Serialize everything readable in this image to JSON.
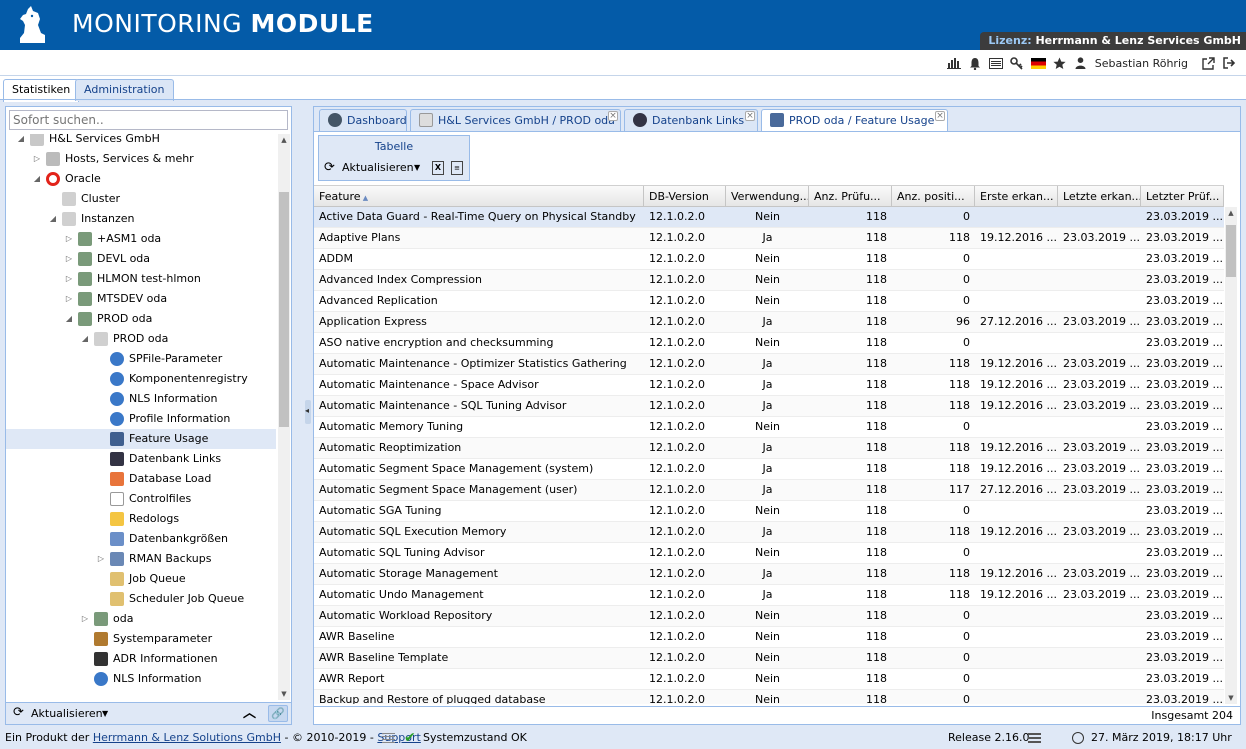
{
  "header": {
    "title_light": "MONITORING ",
    "title_bold": "MODULE",
    "license_label": "Lizenz:",
    "license_value": " Herrmann & Lenz Services GmbH"
  },
  "toolbar": {
    "icons": [
      "chart-icon",
      "bell-icon",
      "list-icon",
      "key-icon",
      "flag-de-icon",
      "star-icon",
      "user-icon",
      "external-link-icon",
      "logout-icon"
    ],
    "user": "Sebastian Röhrig"
  },
  "main_tabs": [
    {
      "label": "Statistiken"
    },
    {
      "label": "Administration"
    }
  ],
  "left": {
    "search_placeholder": "Sofort suchen..",
    "tree": [
      {
        "label": "H&L Services GmbH",
        "level": 2,
        "exp": "open",
        "icon": "building"
      },
      {
        "label": "Hosts, Services & mehr",
        "level": 3,
        "exp": "closed",
        "icon": "server"
      },
      {
        "label": "Oracle",
        "level": 3,
        "exp": "open",
        "icon": "oracle"
      },
      {
        "label": "Cluster",
        "level": 4,
        "exp": "",
        "icon": "db"
      },
      {
        "label": "Instanzen",
        "level": 4,
        "exp": "open",
        "icon": "db"
      },
      {
        "label": "+ASM1 oda",
        "level": 5,
        "exp": "closed",
        "icon": "dbserver"
      },
      {
        "label": "DEVL oda",
        "level": 5,
        "exp": "closed",
        "icon": "dbserver"
      },
      {
        "label": "HLMON test-hlmon",
        "level": 5,
        "exp": "closed",
        "icon": "dbserver"
      },
      {
        "label": "MTSDEV oda",
        "level": 5,
        "exp": "closed",
        "icon": "dbserver"
      },
      {
        "label": "PROD oda",
        "level": 5,
        "exp": "open",
        "icon": "dbserver"
      },
      {
        "label": "PROD oda",
        "level": 6,
        "exp": "open",
        "icon": "db"
      },
      {
        "label": "SPFile-Parameter",
        "level": 7,
        "exp": "",
        "icon": "info"
      },
      {
        "label": "Komponentenregistry",
        "level": 7,
        "exp": "",
        "icon": "info"
      },
      {
        "label": "NLS Information",
        "level": 7,
        "exp": "",
        "icon": "info"
      },
      {
        "label": "Profile Information",
        "level": 7,
        "exp": "",
        "icon": "info"
      },
      {
        "label": "Feature Usage",
        "level": 7,
        "exp": "",
        "icon": "feature",
        "selected": true
      },
      {
        "label": "Datenbank Links",
        "level": 7,
        "exp": "",
        "icon": "links"
      },
      {
        "label": "Database Load",
        "level": 7,
        "exp": "",
        "icon": "load"
      },
      {
        "label": "Controlfiles",
        "level": 7,
        "exp": "",
        "icon": "file"
      },
      {
        "label": "Redologs",
        "level": 7,
        "exp": "",
        "icon": "folder"
      },
      {
        "label": "Datenbankgrößen",
        "level": 7,
        "exp": "",
        "icon": "sizes"
      },
      {
        "label": "RMAN Backups",
        "level": 7,
        "exp": "closed",
        "icon": "backup"
      },
      {
        "label": "Job Queue",
        "level": 7,
        "exp": "",
        "icon": "hourglass"
      },
      {
        "label": "Scheduler Job Queue",
        "level": 7,
        "exp": "",
        "icon": "hourglass"
      },
      {
        "label": "oda",
        "level": 6,
        "exp": "closed",
        "icon": "dbserver"
      },
      {
        "label": "Systemparameter",
        "level": 6,
        "exp": "",
        "icon": "wrench"
      },
      {
        "label": "ADR Informationen",
        "level": 6,
        "exp": "",
        "icon": "monitor"
      },
      {
        "label": "NLS Information",
        "level": 6,
        "exp": "",
        "icon": "info"
      }
    ],
    "footer_refresh": "Aktualisieren"
  },
  "content_tabs": [
    {
      "label": "Dashboard",
      "closable": false
    },
    {
      "label": "H&L Services GmbH / PROD oda",
      "closable": true
    },
    {
      "label": "Datenbank Links",
      "closable": true
    },
    {
      "label": "PROD oda / Feature Usage",
      "closable": true,
      "active": true
    }
  ],
  "table_group": {
    "title": "Tabelle",
    "refresh": "Aktualisieren"
  },
  "grid": {
    "columns": [
      "Feature",
      "DB-Version",
      "Verwendung...",
      "Anz. Prüfu...",
      "Anz. positi...",
      "Erste erkan...",
      "Letzte erkan...",
      "Letzter Prüf..."
    ],
    "rows": [
      [
        "Active Data Guard - Real-Time Query on Physical Standby",
        "12.1.0.2.0",
        "Nein",
        "118",
        "0",
        "",
        "",
        "23.03.2019 ..."
      ],
      [
        "Adaptive Plans",
        "12.1.0.2.0",
        "Ja",
        "118",
        "118",
        "19.12.2016 ...",
        "23.03.2019 ...",
        "23.03.2019 ..."
      ],
      [
        "ADDM",
        "12.1.0.2.0",
        "Nein",
        "118",
        "0",
        "",
        "",
        "23.03.2019 ..."
      ],
      [
        "Advanced Index Compression",
        "12.1.0.2.0",
        "Nein",
        "118",
        "0",
        "",
        "",
        "23.03.2019 ..."
      ],
      [
        "Advanced Replication",
        "12.1.0.2.0",
        "Nein",
        "118",
        "0",
        "",
        "",
        "23.03.2019 ..."
      ],
      [
        "Application Express",
        "12.1.0.2.0",
        "Ja",
        "118",
        "96",
        "27.12.2016 ...",
        "23.03.2019 ...",
        "23.03.2019 ..."
      ],
      [
        "ASO native encryption and checksumming",
        "12.1.0.2.0",
        "Nein",
        "118",
        "0",
        "",
        "",
        "23.03.2019 ..."
      ],
      [
        "Automatic Maintenance - Optimizer Statistics Gathering",
        "12.1.0.2.0",
        "Ja",
        "118",
        "118",
        "19.12.2016 ...",
        "23.03.2019 ...",
        "23.03.2019 ..."
      ],
      [
        "Automatic Maintenance - Space Advisor",
        "12.1.0.2.0",
        "Ja",
        "118",
        "118",
        "19.12.2016 ...",
        "23.03.2019 ...",
        "23.03.2019 ..."
      ],
      [
        "Automatic Maintenance - SQL Tuning Advisor",
        "12.1.0.2.0",
        "Ja",
        "118",
        "118",
        "19.12.2016 ...",
        "23.03.2019 ...",
        "23.03.2019 ..."
      ],
      [
        "Automatic Memory Tuning",
        "12.1.0.2.0",
        "Nein",
        "118",
        "0",
        "",
        "",
        "23.03.2019 ..."
      ],
      [
        "Automatic Reoptimization",
        "12.1.0.2.0",
        "Ja",
        "118",
        "118",
        "19.12.2016 ...",
        "23.03.2019 ...",
        "23.03.2019 ..."
      ],
      [
        "Automatic Segment Space Management (system)",
        "12.1.0.2.0",
        "Ja",
        "118",
        "118",
        "19.12.2016 ...",
        "23.03.2019 ...",
        "23.03.2019 ..."
      ],
      [
        "Automatic Segment Space Management (user)",
        "12.1.0.2.0",
        "Ja",
        "118",
        "117",
        "27.12.2016 ...",
        "23.03.2019 ...",
        "23.03.2019 ..."
      ],
      [
        "Automatic SGA Tuning",
        "12.1.0.2.0",
        "Nein",
        "118",
        "0",
        "",
        "",
        "23.03.2019 ..."
      ],
      [
        "Automatic SQL Execution Memory",
        "12.1.0.2.0",
        "Ja",
        "118",
        "118",
        "19.12.2016 ...",
        "23.03.2019 ...",
        "23.03.2019 ..."
      ],
      [
        "Automatic SQL Tuning Advisor",
        "12.1.0.2.0",
        "Nein",
        "118",
        "0",
        "",
        "",
        "23.03.2019 ..."
      ],
      [
        "Automatic Storage Management",
        "12.1.0.2.0",
        "Ja",
        "118",
        "118",
        "19.12.2016 ...",
        "23.03.2019 ...",
        "23.03.2019 ..."
      ],
      [
        "Automatic Undo Management",
        "12.1.0.2.0",
        "Ja",
        "118",
        "118",
        "19.12.2016 ...",
        "23.03.2019 ...",
        "23.03.2019 ..."
      ],
      [
        "Automatic Workload Repository",
        "12.1.0.2.0",
        "Nein",
        "118",
        "0",
        "",
        "",
        "23.03.2019 ..."
      ],
      [
        "AWR Baseline",
        "12.1.0.2.0",
        "Nein",
        "118",
        "0",
        "",
        "",
        "23.03.2019 ..."
      ],
      [
        "AWR Baseline Template",
        "12.1.0.2.0",
        "Nein",
        "118",
        "0",
        "",
        "",
        "23.03.2019 ..."
      ],
      [
        "AWR Report",
        "12.1.0.2.0",
        "Nein",
        "118",
        "0",
        "",
        "",
        "23.03.2019 ..."
      ],
      [
        "Backup and Restore of plugged database",
        "12.1.0.2.0",
        "Nein",
        "118",
        "0",
        "",
        "",
        "23.03.2019 ..."
      ]
    ],
    "total": "Insgesamt 204"
  },
  "statusbar": {
    "prefix": "Ein Produkt der ",
    "company": "Herrmann & Lenz Solutions GmbH",
    "copyright": " - © 2010-2019 - ",
    "support": "Support",
    "system_status": "Systemzustand OK",
    "release": "Release 2.16.0",
    "datetime": "27. März 2019, 18:17 Uhr"
  },
  "colors": {
    "header_bg": "#045ba8",
    "panel_border": "#99bbe8",
    "tab_text": "#15428b",
    "ok_green": "#2a9d2a",
    "oracle_red": "#e2231a"
  }
}
